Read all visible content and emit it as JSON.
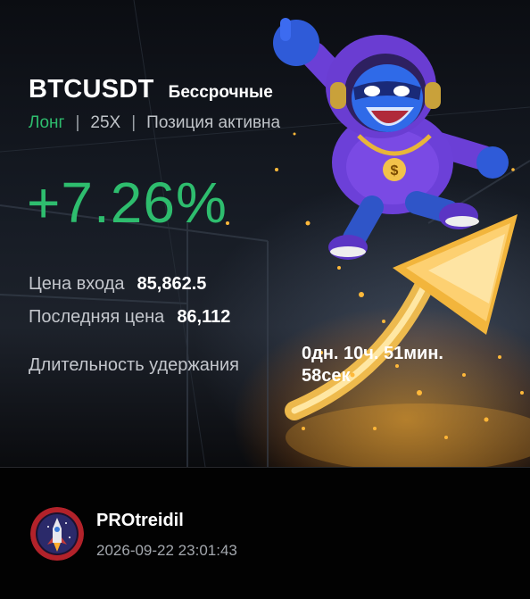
{
  "position": {
    "symbol": "BTCUSDT",
    "contract_type": "Бессрочные",
    "side": "Лонг",
    "leverage": "25X",
    "status": "Позиция активна",
    "pnl_percent": "+7.26%"
  },
  "stats": {
    "entry_label": "Цена входа",
    "entry_value": "85,862.5",
    "last_label": "Последняя цена",
    "last_value": "86,112",
    "hold_label": "Длительность удержания",
    "hold_value_line1": "0дн. 10ч. 51мин.",
    "hold_value_line2": "58сек"
  },
  "user": {
    "name": "PROtreidil",
    "timestamp": "2026-09-22 23:01:43"
  },
  "colors": {
    "profit_green": "#2ebd6e",
    "background": "#000000"
  },
  "icons": {
    "mascot": "hooded-mascot-illustration",
    "arrow": "golden-up-arrow",
    "avatar": "rocket-avatar-icon"
  }
}
